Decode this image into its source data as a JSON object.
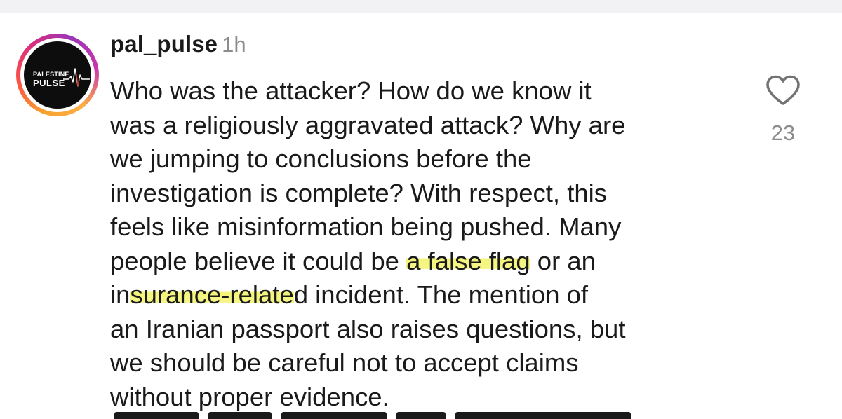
{
  "comment": {
    "username": "pal_pulse",
    "timestamp": "1h",
    "avatar": {
      "logo_top": "PALESTINE",
      "logo_bottom": "PULSE",
      "ring_colors": [
        "#f9a12e",
        "#fc5245",
        "#d92e7f",
        "#9b36b7"
      ]
    },
    "text_segments": [
      "Who was the attacker? How do we know it\nwas a religiously aggravated attack? Why are\nwe jumping to conclusions before the\ninvestigation is complete? With respect, this\nfeels like misinformation being pushed. Many\npeople believe it could be ",
      "a false flag",
      " or an\nin",
      "surance-relate",
      "d incident. The mention of\nan Iranian passport also raises questions, but\nwe should be careful not to accept claims\nwithout proper evidence."
    ],
    "like_icon": "heart-outline-icon",
    "like_count": "23",
    "highlight_color": "#f6f68a"
  }
}
